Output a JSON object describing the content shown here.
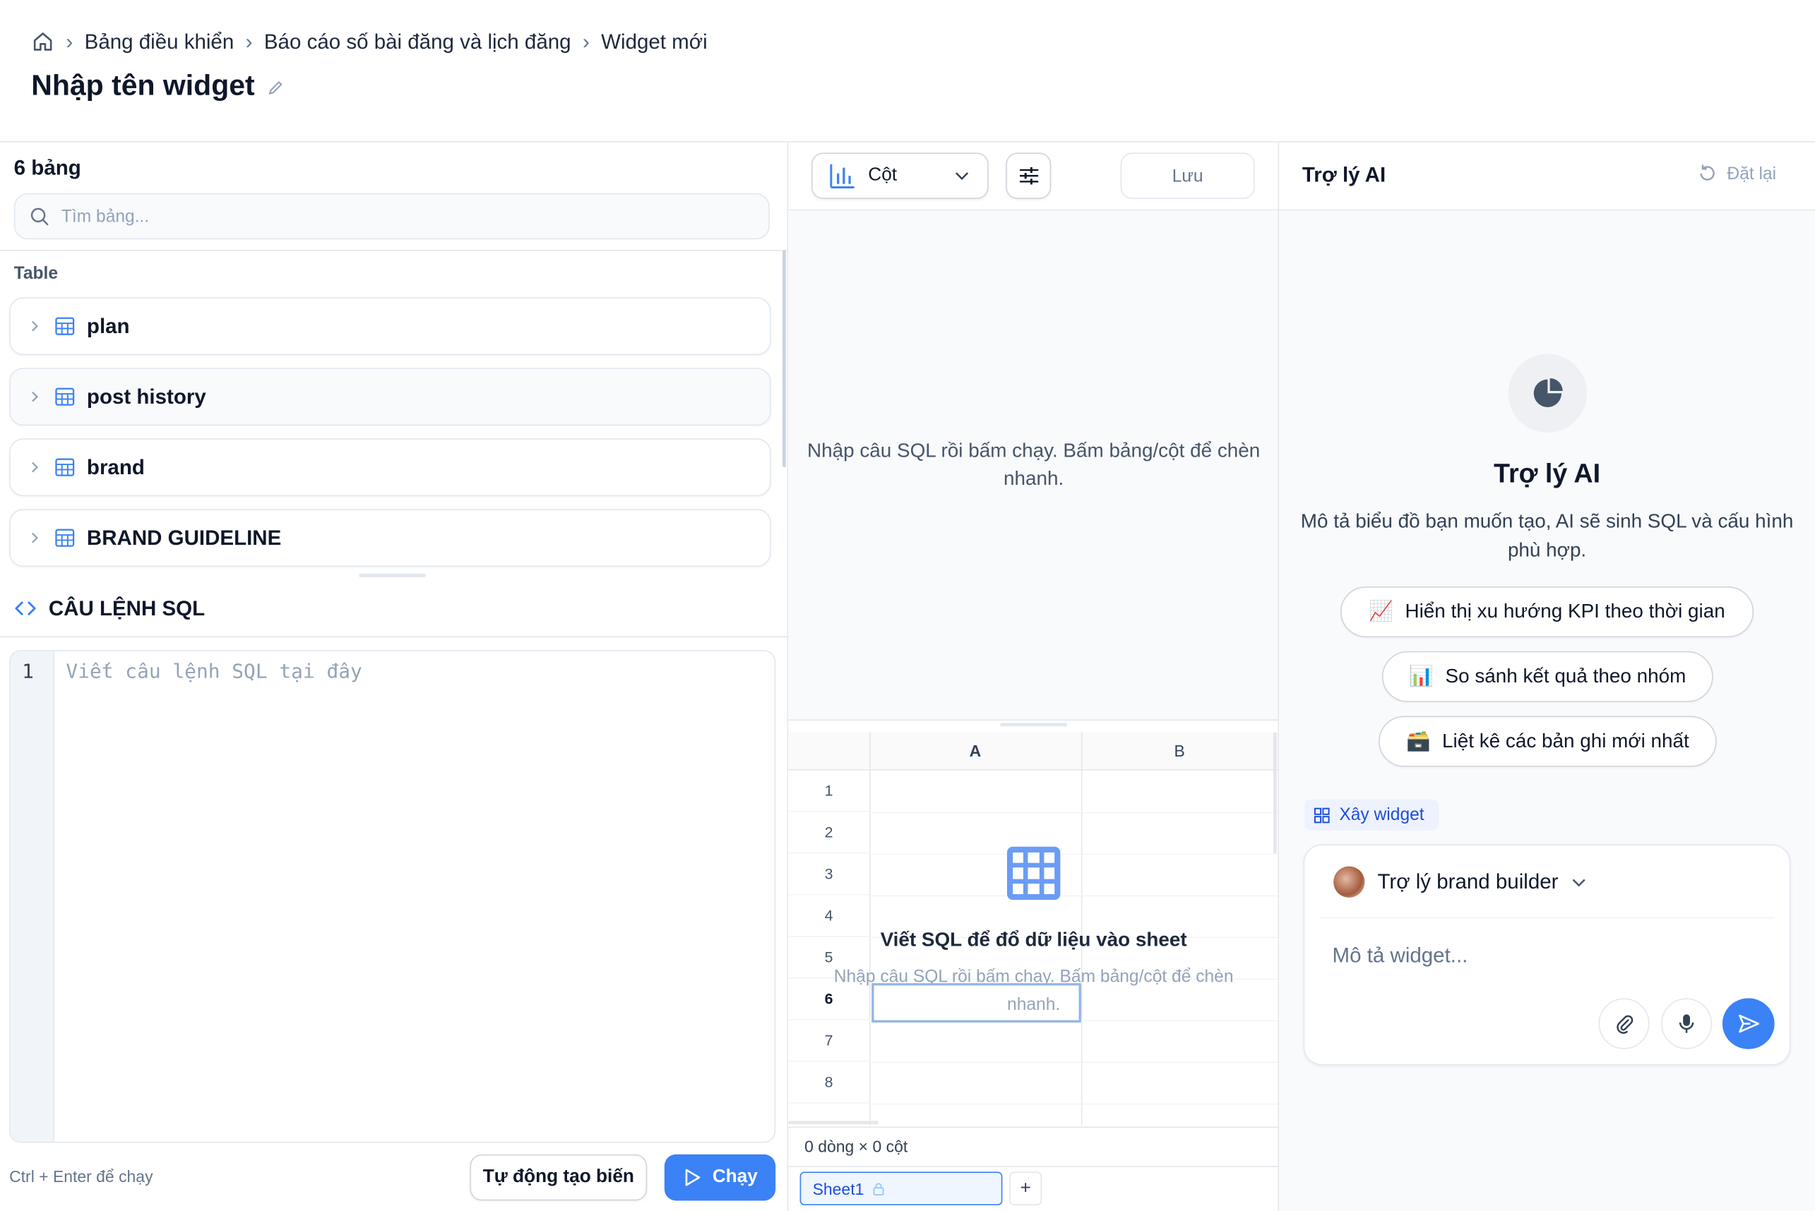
{
  "breadcrumb": {
    "items": [
      "Bảng điều khiển",
      "Báo cáo số bài đăng và lịch đăng",
      "Widget mới"
    ]
  },
  "page": {
    "title": "Nhập tên widget"
  },
  "left_panel": {
    "count_label": "6 bảng",
    "search_placeholder": "Tìm bảng...",
    "section_label": "Table",
    "tables": [
      "plan",
      "post history",
      "brand",
      "BRAND GUIDELINE"
    ]
  },
  "sql": {
    "header": "CÂU LỆNH SQL",
    "line_number": "1",
    "placeholder": "Viết câu lệnh SQL tại đây",
    "hint": "Ctrl + Enter để chạy",
    "auto_button": "Tự động tạo biến",
    "run_button": "Chạy"
  },
  "middle_panel": {
    "chart_type": "Cột",
    "save_button": "Lưu",
    "preview_message": "Nhập câu SQL rồi bấm chạy. Bấm bảng/cột để chèn nhanh.",
    "grid": {
      "columns": [
        "A",
        "B"
      ],
      "rows": [
        "1",
        "2",
        "3",
        "4",
        "5",
        "6",
        "7",
        "8"
      ],
      "empty_title": "Viết SQL để đổ dữ liệu vào sheet",
      "empty_subtitle": "Nhập câu SQL rồi bấm chạy. Bấm bảng/cột để chèn nhanh."
    },
    "status": "0 dòng × 0 cột",
    "sheet_tab": "Sheet1",
    "add_sheet": "+"
  },
  "right_panel": {
    "header": "Trợ lý AI",
    "reset_button": "Đặt lại",
    "hero_title": "Trợ lý AI",
    "hero_description": "Mô tả biểu đồ bạn muốn tạo, AI sẽ sinh SQL và cấu hình phù hợp.",
    "suggestions": [
      {
        "emoji": "📈",
        "label": "Hiển thị xu hướng KPI theo thời gian"
      },
      {
        "emoji": "📊",
        "label": "So sánh kết quả theo nhóm"
      },
      {
        "emoji": "🗃️",
        "label": "Liệt kê các bản ghi mới nhất"
      }
    ],
    "build_tag": "Xây widget",
    "agent_name": "Trợ lý brand builder",
    "composer_placeholder": "Mô tả widget..."
  },
  "colors": {
    "accent": "#3b82f6",
    "border": "#e2e8f0",
    "muted_text": "#64748b"
  }
}
